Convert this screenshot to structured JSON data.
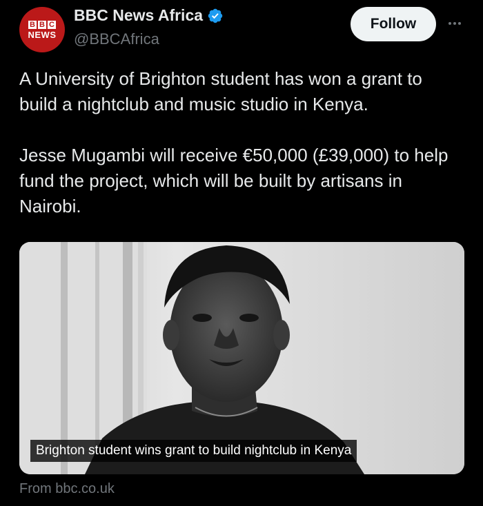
{
  "author": {
    "display_name": "BBC News Africa",
    "handle": "@BBCAfrica",
    "avatar_letters": [
      "B",
      "B",
      "C"
    ],
    "avatar_word": "NEWS",
    "verified": true,
    "verified_color": "#1d9bf0",
    "avatar_color": "#bb1919"
  },
  "actions": {
    "follow_label": "Follow",
    "more_icon": "more-horizontal-icon"
  },
  "tweet": {
    "paragraph_1": "A University of Brighton student has won a grant to build a nightclub and music studio in Kenya.",
    "paragraph_2": "Jesse Mugambi will receive €50,000 (£39,000) to help fund the project, which will be built by artisans in Nairobi."
  },
  "media": {
    "caption": "Brighton student wins grant to build nightclub in Kenya",
    "style": "black-and-white photo"
  },
  "card": {
    "source": "From bbc.co.uk"
  }
}
